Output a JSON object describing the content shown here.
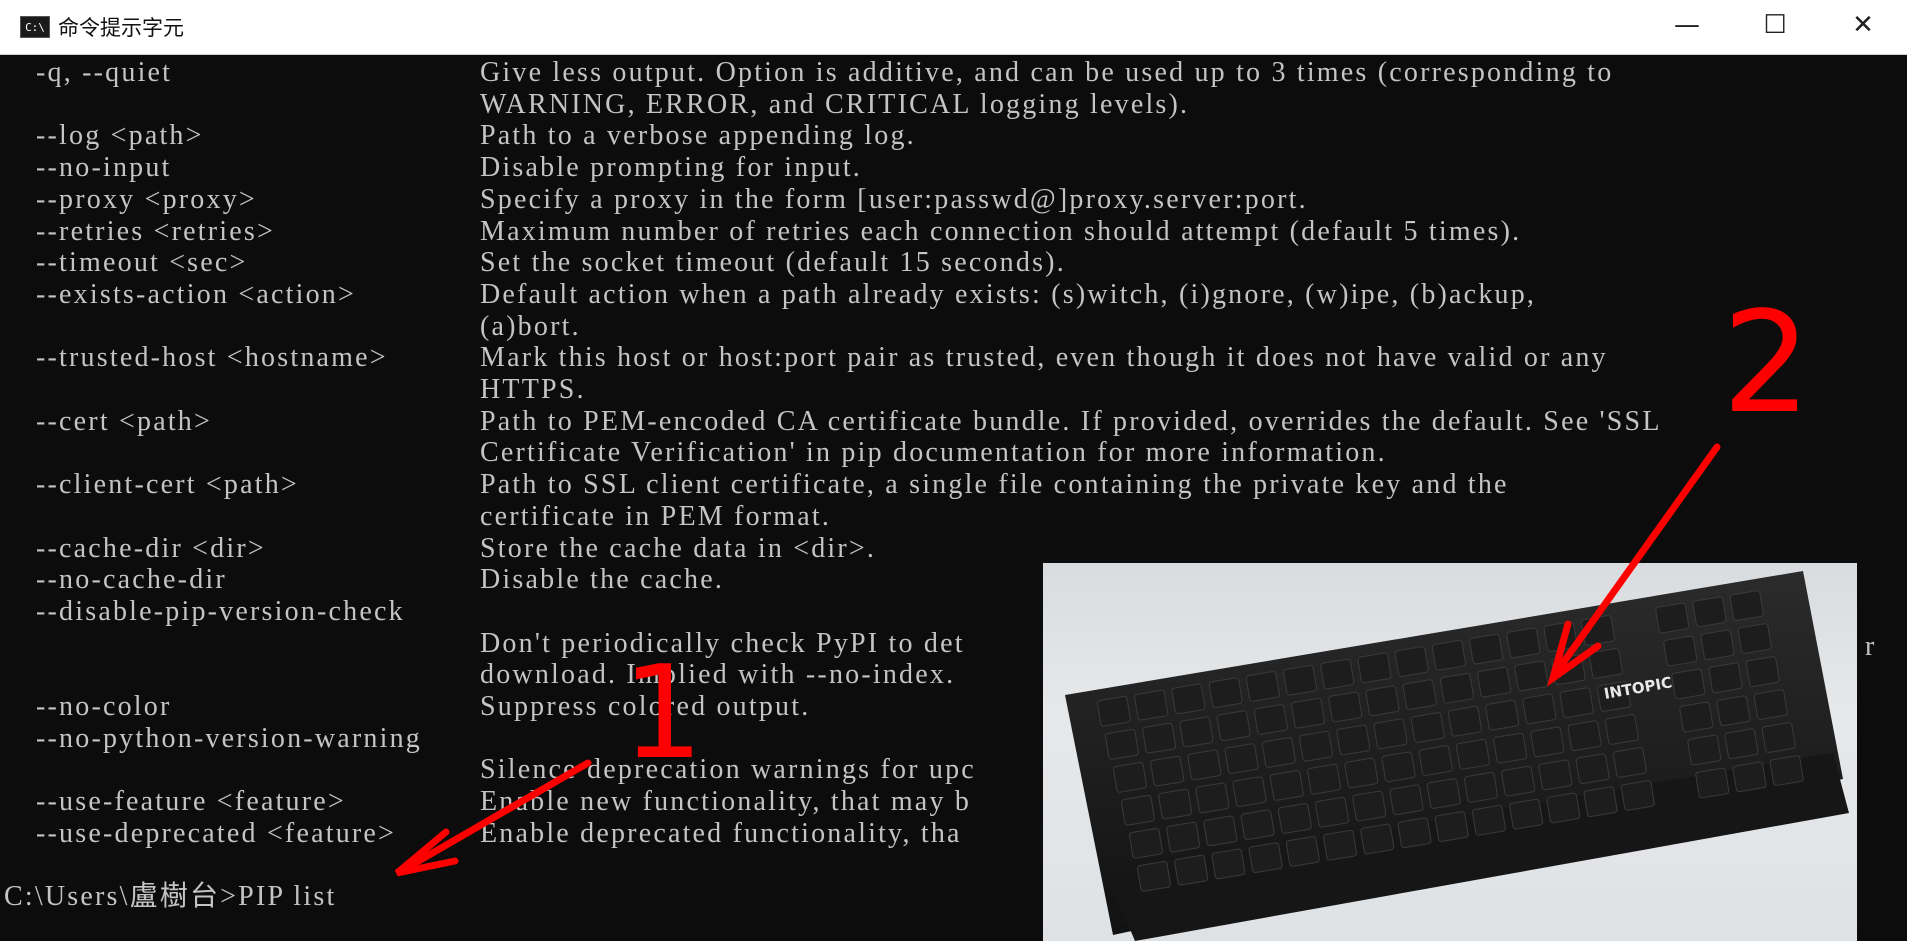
{
  "window": {
    "title": "命令提示字元",
    "icon_label": "C:\\",
    "minimize_glyph": "—",
    "maximize_glyph": "☐",
    "close_glyph": "✕"
  },
  "options": [
    {
      "flag": "-q, --quiet",
      "desc": [
        "Give less output. Option is additive, and can be used up to 3 times (corresponding to",
        "WARNING, ERROR, and CRITICAL logging levels)."
      ]
    },
    {
      "flag": "--log <path>",
      "desc": [
        "Path to a verbose appending log."
      ]
    },
    {
      "flag": "--no-input",
      "desc": [
        "Disable prompting for input."
      ]
    },
    {
      "flag": "--proxy <proxy>",
      "desc": [
        "Specify a proxy in the form [user:passwd@]proxy.server:port."
      ]
    },
    {
      "flag": "--retries <retries>",
      "desc": [
        "Maximum number of retries each connection should attempt (default 5 times)."
      ]
    },
    {
      "flag": "--timeout <sec>",
      "desc": [
        "Set the socket timeout (default 15 seconds)."
      ]
    },
    {
      "flag": "--exists-action <action>",
      "desc": [
        "Default action when a path already exists: (s)witch, (i)gnore, (w)ipe, (b)ackup,",
        "(a)bort."
      ]
    },
    {
      "flag": "--trusted-host <hostname>",
      "desc": [
        "Mark this host or host:port pair as trusted, even though it does not have valid or any",
        "HTTPS."
      ]
    },
    {
      "flag": "--cert <path>",
      "desc": [
        "Path to PEM-encoded CA certificate bundle. If provided, overrides the default. See 'SSL",
        "Certificate Verification' in pip documentation for more information."
      ]
    },
    {
      "flag": "--client-cert <path>",
      "desc": [
        "Path to SSL client certificate, a single file containing the private key and the",
        "certificate in PEM format."
      ]
    },
    {
      "flag": "--cache-dir <dir>",
      "desc": [
        "Store the cache data in <dir>."
      ]
    },
    {
      "flag": "--no-cache-dir",
      "desc": [
        "Disable the cache."
      ]
    },
    {
      "flag": "--disable-pip-version-check",
      "desc": [
        "",
        "Don't periodically check PyPI to det",
        "download. Implied with --no-index."
      ]
    },
    {
      "flag": "--no-color",
      "desc": [
        "Suppress colored output."
      ]
    },
    {
      "flag": "--no-python-version-warning",
      "desc": [
        "",
        "Silence deprecation warnings for upc"
      ]
    },
    {
      "flag": "--use-feature <feature>",
      "desc": [
        "Enable new functionality, that may b"
      ]
    },
    {
      "flag": "--use-deprecated <feature>",
      "desc": [
        "Enable deprecated functionality, tha"
      ]
    }
  ],
  "right_edge_fragment": "r",
  "prompt": "C:\\Users\\盧樹台>PIP list",
  "annotations": {
    "label_1": "1",
    "label_2": "2",
    "color": "#ff0000"
  },
  "keyboard": {
    "brand": "INTOPIC"
  }
}
